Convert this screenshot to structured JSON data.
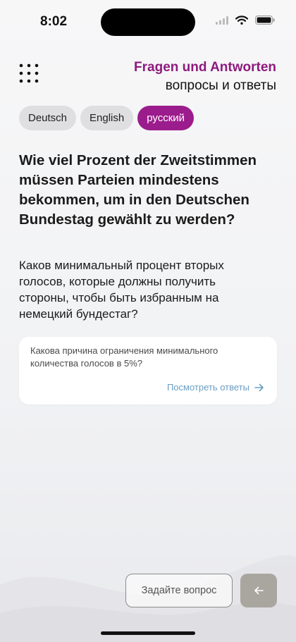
{
  "status_bar": {
    "time": "8:02",
    "icons": [
      "cellular-signal-icon",
      "wifi-icon",
      "battery-icon"
    ]
  },
  "header": {
    "title": "Fragen und Antworten",
    "subtitle": "вопросы и ответы",
    "menu_icon": "grid-menu-icon"
  },
  "languages": [
    {
      "label": "Deutsch",
      "active": false
    },
    {
      "label": "English",
      "active": false
    },
    {
      "label": "русский",
      "active": true
    }
  ],
  "question": {
    "german": "Wie viel Prozent der Zweitstimmen müssen Parteien mindestens bekommen, um in den Deutschen Bundestag gewählt zu werden?",
    "russian": "Каков минимальный процент вторых голосов, которые должны получить стороны, чтобы быть избранным на немецкий бундестаг?"
  },
  "related_card": {
    "text": "Какова причина ограничения минимального количества голосов в 5%?",
    "link_label": "Посмотреть ответы",
    "link_icon": "arrow-right-icon"
  },
  "footer": {
    "ask_label": "Задайте вопрос",
    "back_icon": "arrow-left-icon"
  },
  "colors": {
    "brand": "#8e1a7e",
    "active_tab": "#9b1c8c",
    "link": "#6b9ec3",
    "back_button": "#a9a6a0"
  }
}
